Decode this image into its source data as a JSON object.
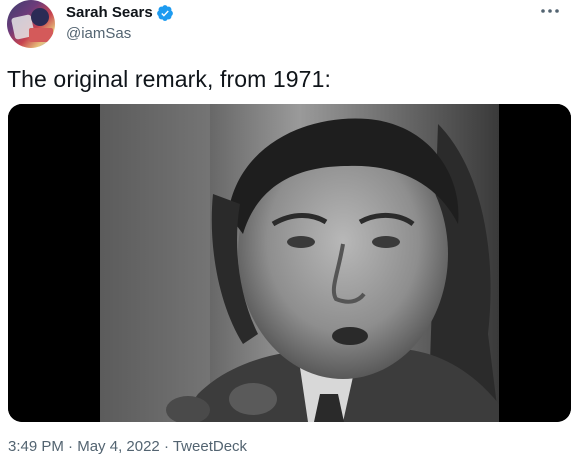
{
  "author": {
    "display_name": "Sarah Sears",
    "handle": "@iamSas",
    "verified": true,
    "avatar_icon": "avatar-photo"
  },
  "menu_icon": "more-options-icon",
  "tweet": {
    "text": "The original remark, from 1971:",
    "media_type": "video-still"
  },
  "meta": {
    "time": "3:49 PM",
    "separator": " · ",
    "date": "May 4, 2022",
    "source": "TweetDeck"
  },
  "colors": {
    "verified_badge": "#1d9bf0",
    "secondary_text": "#536471",
    "primary_text": "#0f1419"
  }
}
